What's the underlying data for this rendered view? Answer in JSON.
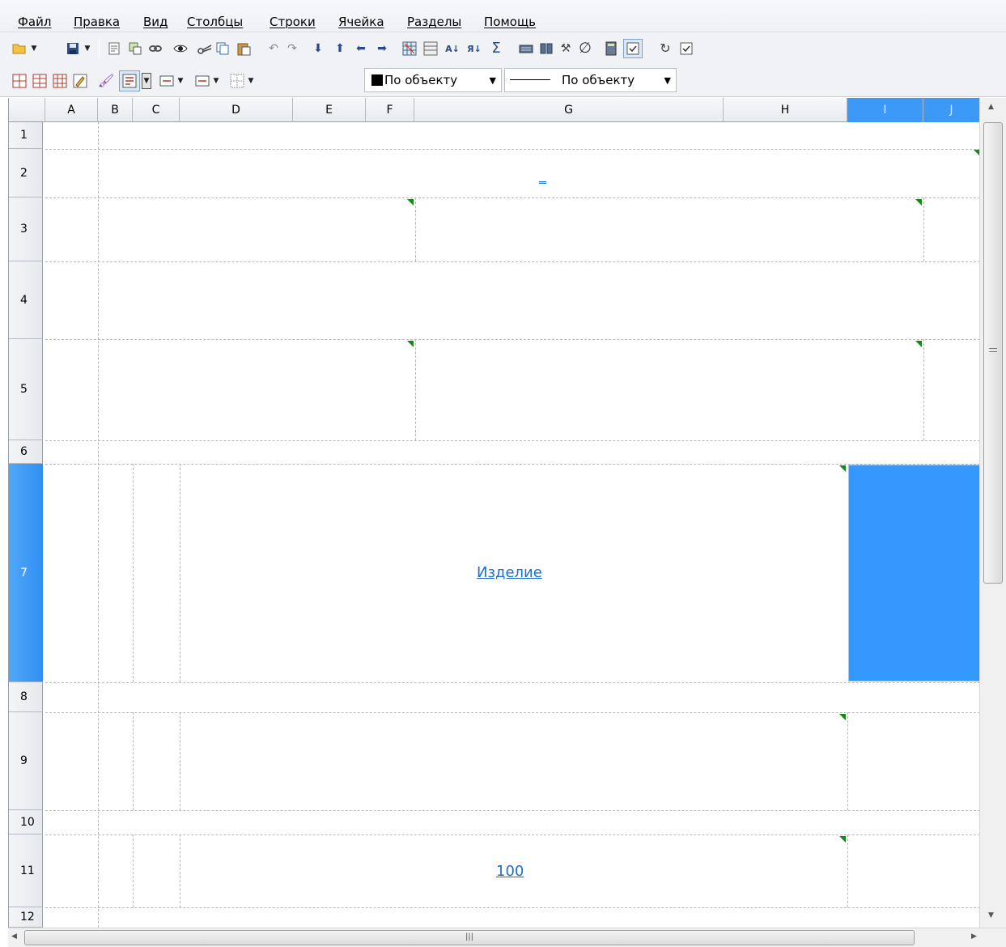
{
  "menu": [
    "Файл",
    "Правка",
    "Вид",
    "Столбцы",
    "Строки",
    "Ячейка",
    "Разделы",
    "Помощь"
  ],
  "toolbar": {
    "color_combo": "По объекту",
    "line_combo": "По объекту"
  },
  "columns": [
    "A",
    "B",
    "C",
    "D",
    "E",
    "F",
    "G",
    "H",
    "I",
    "J"
  ],
  "selected_column": "I",
  "rows": [
    "1",
    "2",
    "3",
    "4",
    "5",
    "6",
    "7",
    "8",
    "9",
    "10",
    "11",
    "12"
  ],
  "selected_row": "7",
  "cells": {
    "r2_link": "_",
    "r7_link": "Изделие",
    "r11_link": "100"
  },
  "colors": {
    "selection": "#3399ff",
    "link": "#1b6fd0",
    "comment_marker": "#138a13"
  },
  "icons": {
    "toolbar1": [
      "open-folder-icon",
      "save-icon",
      "properties-icon",
      "copy-format-icon",
      "link-icon",
      "preview-eye-icon",
      "cut-icon",
      "copy-icon",
      "paste-icon",
      "undo-icon",
      "redo-icon",
      "arrow-down-icon",
      "arrow-up-icon",
      "arrow-left-icon",
      "arrow-right-icon",
      "grid-icon",
      "table-icon",
      "sort-asc-icon",
      "sort-desc-icon",
      "sum-icon",
      "keyboard-icon",
      "book-icon",
      "tool-icon",
      "empty-set-icon",
      "calculator-icon",
      "checkbox-icon",
      "refresh-icon",
      "check-icon"
    ],
    "toolbar2": [
      "insert-row-icon",
      "merge-cells-icon",
      "split-cells-icon",
      "edit-cell-icon",
      "paint-brush-icon",
      "text-align-icon",
      "h-align-icon",
      "v-align-icon",
      "borders-icon"
    ]
  }
}
